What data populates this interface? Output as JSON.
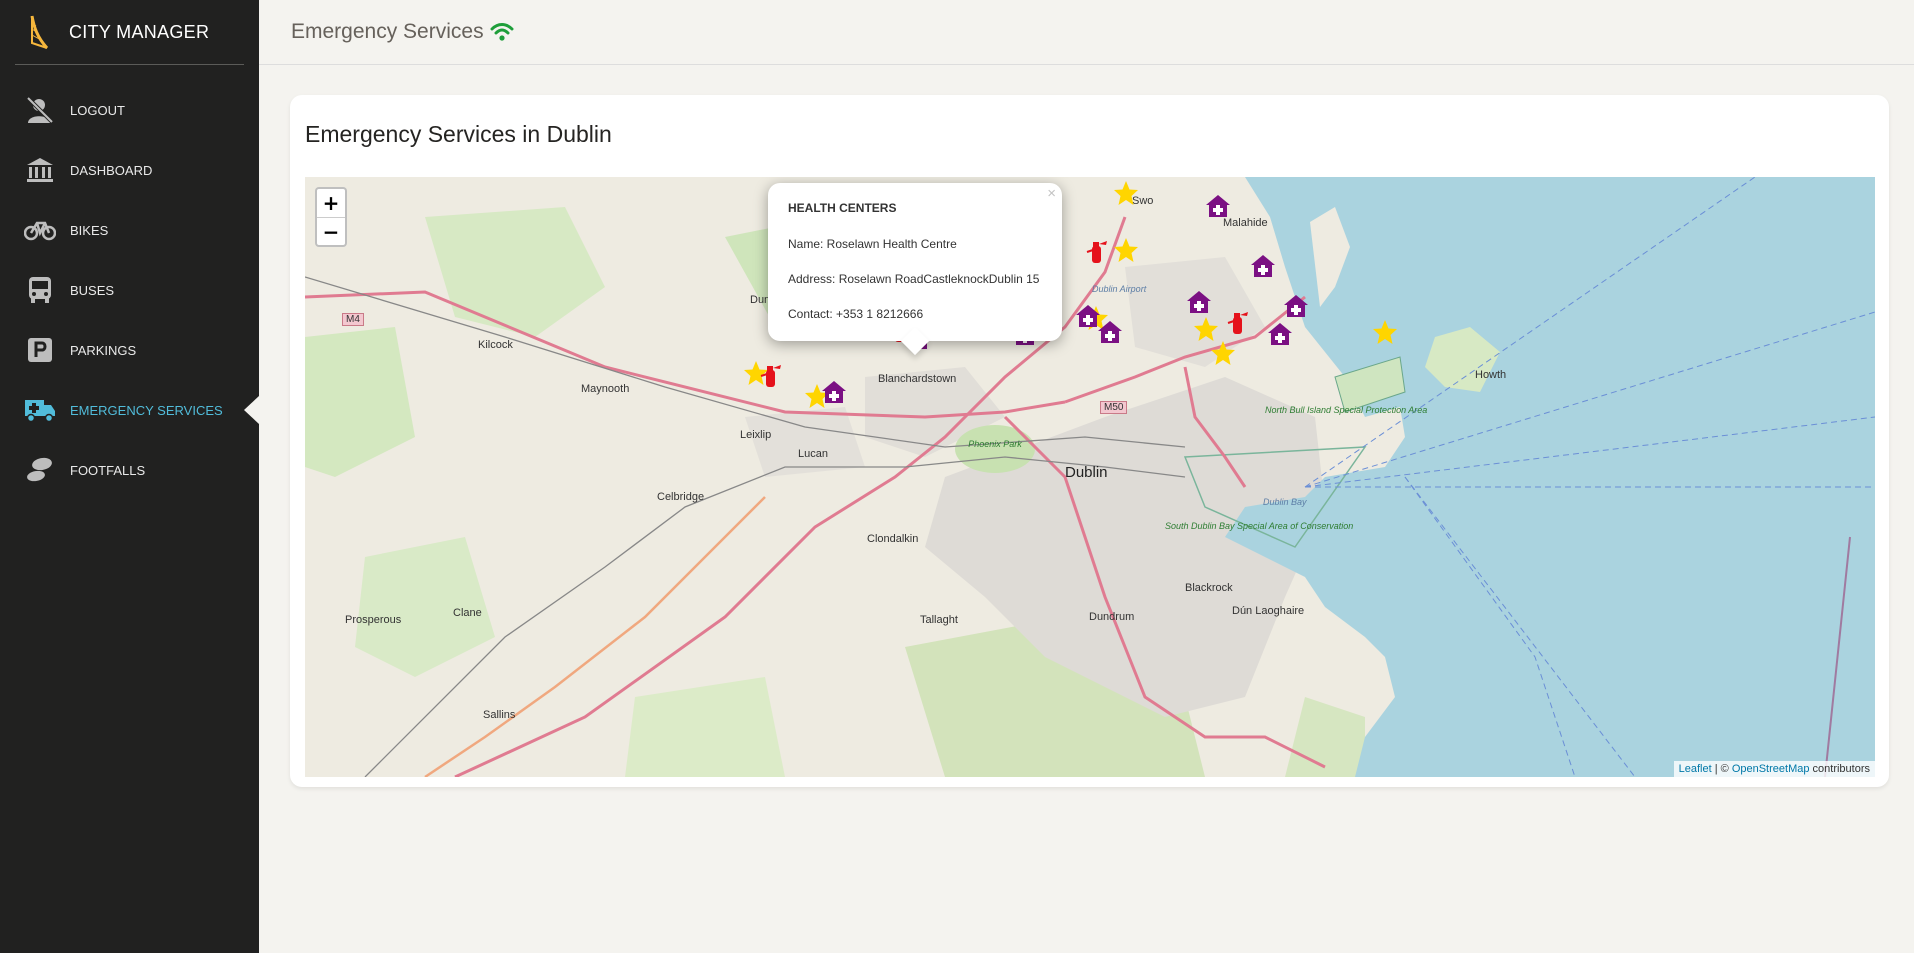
{
  "sidebar": {
    "brand": "CITY MANAGER",
    "items": [
      {
        "label": "LOGOUT",
        "icon": "logout-user-icon"
      },
      {
        "label": "DASHBOARD",
        "icon": "bank-icon"
      },
      {
        "label": "BIKES",
        "icon": "bike-icon"
      },
      {
        "label": "BUSES",
        "icon": "bus-icon"
      },
      {
        "label": "PARKINGS",
        "icon": "parking-icon"
      },
      {
        "label": "EMERGENCY SERVICES",
        "icon": "ambulance-icon",
        "active": true
      },
      {
        "label": "FOOTFALLS",
        "icon": "footprints-icon"
      }
    ]
  },
  "topbar": {
    "title": "Emergency Services",
    "status_icon": "wifi-icon",
    "status_color": "#1e9e3a"
  },
  "card": {
    "title": "Emergency Services in Dublin"
  },
  "map": {
    "zoom_in": "+",
    "zoom_out": "−",
    "attribution": {
      "leaflet": "Leaflet",
      "separator": " | © ",
      "osm": "OpenStreetMap",
      "suffix": " contributors"
    },
    "popup": {
      "close": "×",
      "category": "HEALTH CENTERS",
      "name_line": "Name: Roselawn Health Centre",
      "address_line": "Address: Roselawn RoadCastleknockDublin 15",
      "contact_line": "Contact: +353 1 8212666"
    },
    "places": {
      "dublin": "Dublin",
      "swords": "Swo",
      "malahide": "Malahide",
      "howth": "Howth",
      "kilcock": "Kilcock",
      "maynooth": "Maynooth",
      "leixlip": "Leixlip",
      "lucan": "Lucan",
      "blanchardstown": "Blanchardstown",
      "celbridge": "Celbridge",
      "clondalkin": "Clondalkin",
      "tallaght": "Tallaght",
      "dundrum": "Dundrum",
      "blackrock": "Blackrock",
      "dunlaoghaire": "Dún Laoghaire",
      "clane": "Clane",
      "prosperous": "Prosperous",
      "sallins": "Sallins",
      "phoenix": "Phoenix Park",
      "airport": "Dublin Airport",
      "dunboyne": "Dun",
      "bull": "North Bull Island Special Protection Area",
      "southbay": "South Dublin Bay Special Area of Conservation",
      "dublinbay": "Dublin Bay",
      "m4": "M4",
      "m50": "M50"
    },
    "marker_colors": {
      "health": "#7b1083",
      "fire": "#e5121b",
      "star": "#ffd500"
    }
  }
}
